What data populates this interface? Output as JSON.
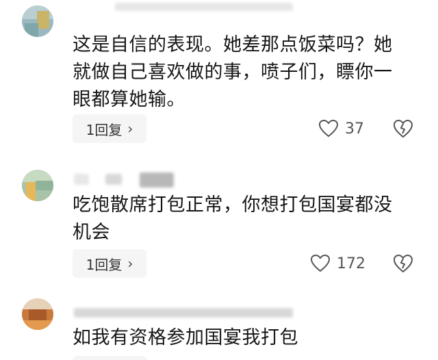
{
  "comments": [
    {
      "text_lines": [
        "这是自信的表现。她差那点饭菜吗？她",
        "就做自己喜欢做的事，喷子们，瞟你一",
        "眼都算她输。"
      ],
      "reply_label": "1回复",
      "like_count": "37"
    },
    {
      "text_lines": [
        "吃饱散席打包正常，你想打包国宴都没",
        "机会"
      ],
      "reply_label": "1回复",
      "like_count": "172"
    },
    {
      "text_lines": [
        "如我有资格参加国宴我打包"
      ]
    }
  ],
  "icons": {
    "like": "heart-outline-icon",
    "dislike": "broken-heart-icon",
    "reply_chevron": "chevron-right-icon"
  },
  "colors": {
    "text": "#161616",
    "muted": "#555555",
    "button_bg": "#f5f5f5"
  }
}
